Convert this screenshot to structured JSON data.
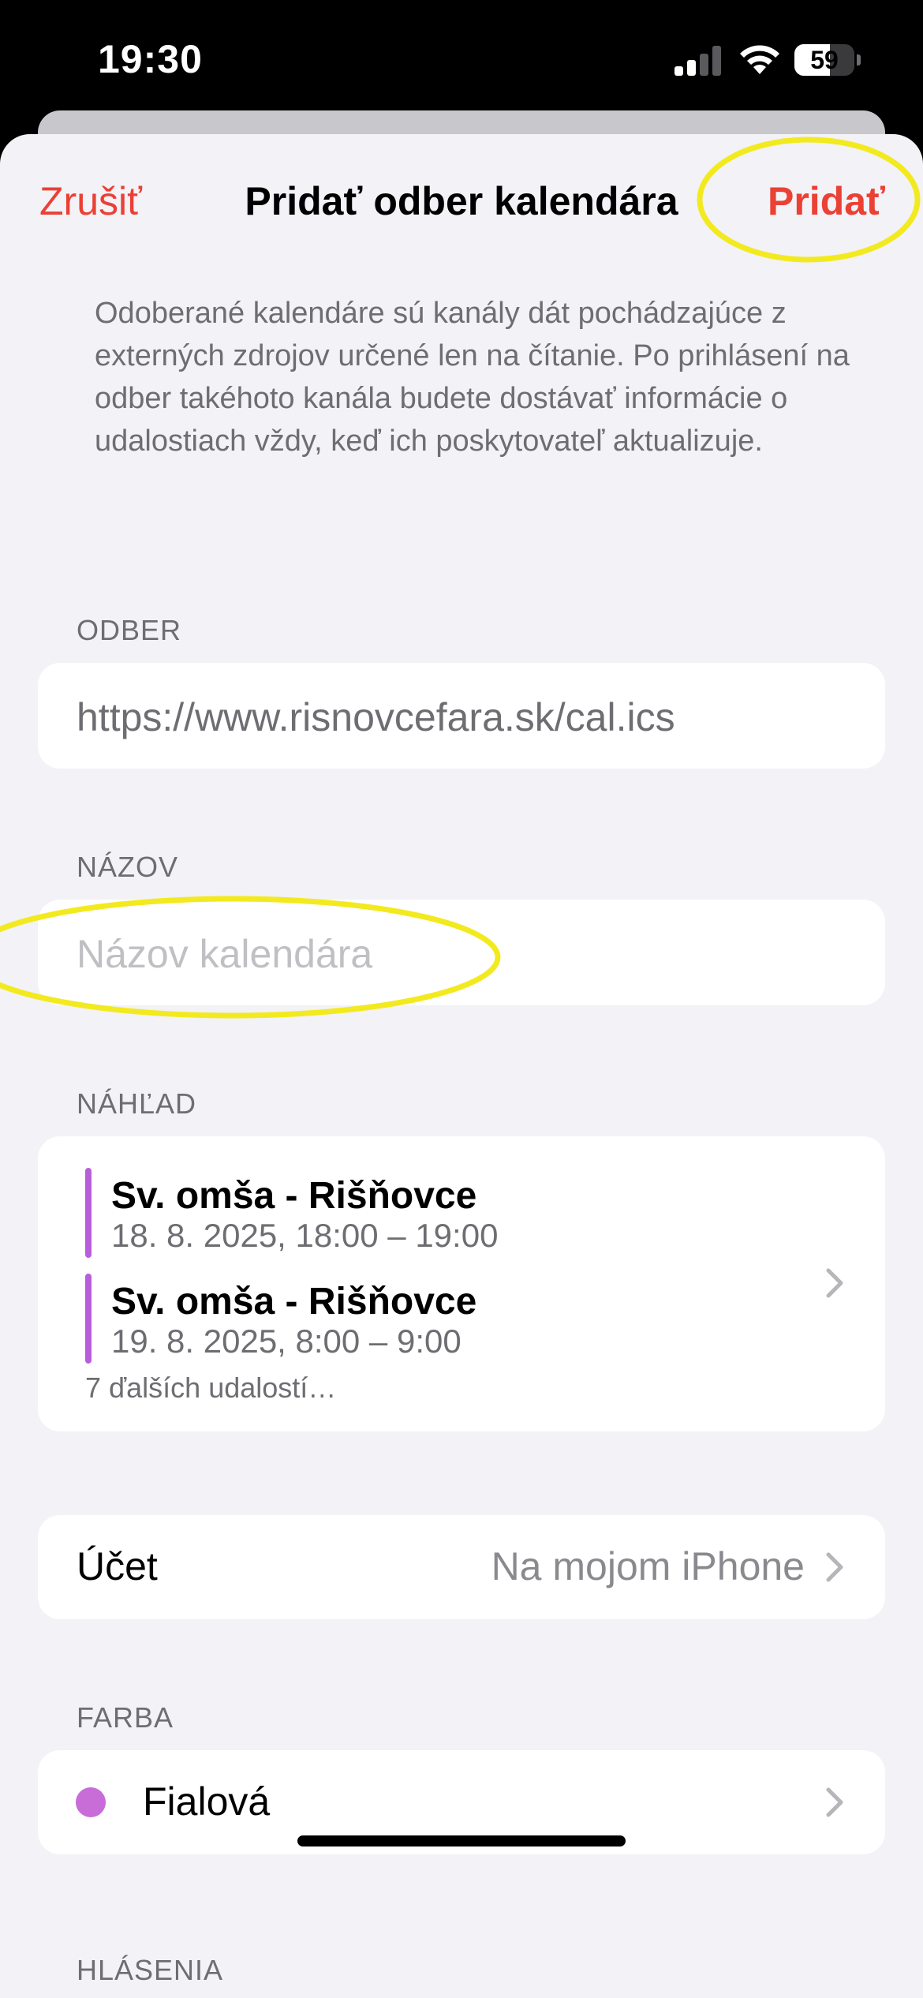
{
  "status_bar": {
    "time": "19:30",
    "battery_level": "59",
    "battery_fraction": 0.59
  },
  "nav": {
    "cancel_label": "Zrušiť",
    "title": "Pridať odber kalendára",
    "add_label": "Pridať"
  },
  "info_text": "Odoberané kalendáre sú kanály dát pochádzajúce z externých zdrojov určené len na čítanie. Po prihlásení na odber takéhoto kanála budete dostávať informácie o udalostiach vždy, keď ich poskytovateľ aktualizuje.",
  "subscription": {
    "header": "ODBER",
    "url": "https://www.risnovcefara.sk/cal.ics"
  },
  "name": {
    "header": "NÁZOV",
    "placeholder": "Názov kalendára"
  },
  "preview": {
    "header": "NÁHĽAD",
    "events": [
      {
        "title": "Sv. omša - Rišňovce",
        "time": "18. 8. 2025, 18:00 – 19:00"
      },
      {
        "title": "Sv. omša - Rišňovce",
        "time": "19. 8. 2025, 8:00 – 9:00"
      }
    ],
    "more": "7 ďalších udalostí…"
  },
  "account": {
    "label": "Účet",
    "value": "Na mojom iPhone"
  },
  "color": {
    "header": "FARBA",
    "label": "Fialová",
    "hex": "#c86dd7"
  },
  "alerts": {
    "header": "HLÁSENIA"
  },
  "colors": {
    "accent": "#eb4034",
    "event_bar": "#b95edb",
    "annotation": "#f2ea1e"
  },
  "icons": {
    "signal": "cellular-signal-icon",
    "wifi": "wifi-icon",
    "battery": "battery-icon",
    "chevron": "chevron-right-icon"
  }
}
